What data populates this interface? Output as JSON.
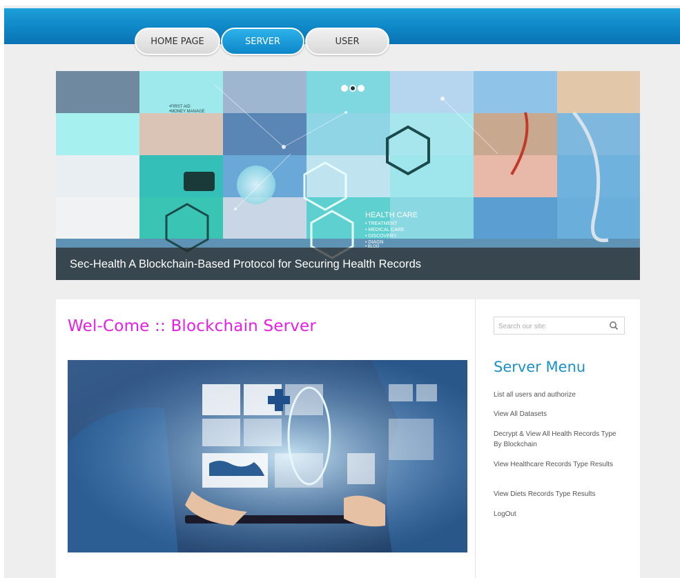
{
  "nav": {
    "tabs": [
      {
        "label": "HOME PAGE",
        "active": false
      },
      {
        "label": "SERVER",
        "active": true
      },
      {
        "label": "USER",
        "active": false
      }
    ]
  },
  "banner": {
    "caption": "Sec-Health A Blockchain-Based Protocol for Securing Health Records",
    "tile_texts": [
      "•FIRST AID",
      "•MONEY MANAGE",
      "HEALTH CARE",
      "• TREATMENT",
      "• MEDICAL CARE",
      "• DISCOVERY",
      "• DIAGN",
      "• BLOO"
    ]
  },
  "main": {
    "title": "Wel-Come :: Blockchain Server"
  },
  "sidebar": {
    "search_placeholder": "Search our site:",
    "menu_title": "Server Menu",
    "menu_items": [
      "List all users and authorize",
      "View All Datasets",
      "Decrypt & View All Health Records Type By Blockchain",
      "View Healthcare Records Type Results",
      "View Diets Records Type Results",
      "LogOut"
    ]
  },
  "colors": {
    "header_blue": "#0f86c6",
    "title_magenta": "#e61ee6",
    "menu_title_blue": "#1a90c8",
    "page_bg": "#eeeeee"
  }
}
